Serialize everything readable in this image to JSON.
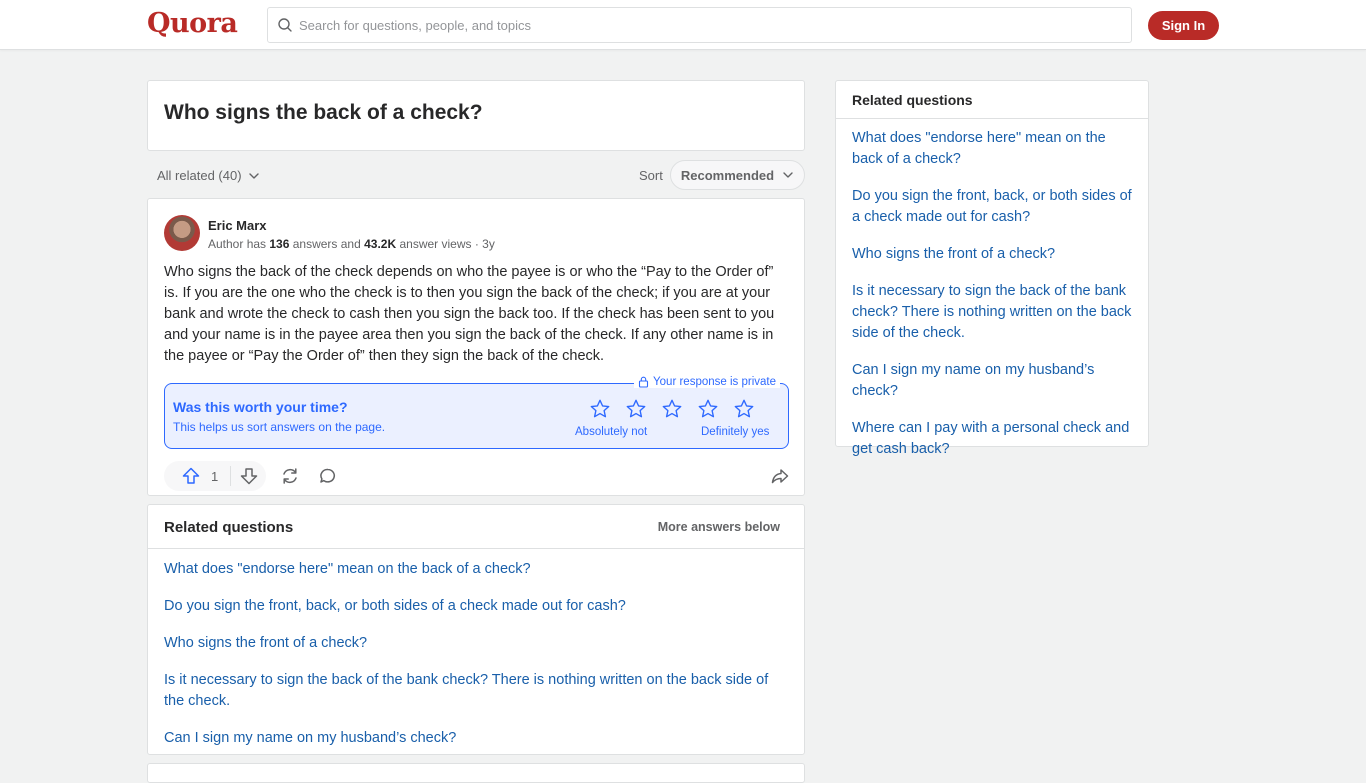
{
  "header": {
    "logo": "Quora",
    "search_placeholder": "Search for questions, people, and topics",
    "signin_label": "Sign In",
    "brand_color": "#b92b27"
  },
  "question": {
    "title": "Who signs the back of a check?"
  },
  "filters": {
    "all_related": "All related (40)",
    "sort_label": "Sort",
    "sort_value": "Recommended"
  },
  "answer": {
    "author": "Eric Marx",
    "meta_prefix": "Author has ",
    "answers_count": "136",
    "meta_mid": " answers and ",
    "views_count": "43.2K",
    "meta_suffix": " answer views · 3y",
    "text": "Who signs the back of the check depends on who the payee is or who the “Pay to the Order of” is. If you are the one who the check is to then you sign the back of the check; if you are at your bank and wrote the check to cash then you sign the back too. If the check has been sent to you and your name is in the payee area then you sign the back of the check. If any other name is in the payee or “Pay the Order of” then they sign the back of the check.",
    "upvotes": "1"
  },
  "survey": {
    "private_label": "Your response is private",
    "title": "Was this worth your time?",
    "subtitle": "This helps us sort answers on the page.",
    "low_label": "Absolutely not",
    "high_label": "Definitely yes",
    "accent_color": "#2e69ff"
  },
  "related": {
    "title": "Related questions",
    "more_below": "More answers below",
    "items": [
      "What does \"endorse here\" mean on the back of a check?",
      "Do you sign the front, back, or both sides of a check made out for cash?",
      "Who signs the front of a check?",
      "Is it necessary to sign the back of the bank check? There is nothing written on the back side of the check.",
      "Can I sign my name on my husband’s check?"
    ]
  },
  "sidebar": {
    "title": "Related questions",
    "items": [
      "What does \"endorse here\" mean on the back of a check?",
      "Do you sign the front, back, or both sides of a check made out for cash?",
      "Who signs the front of a check?",
      "Is it necessary to sign the back of the bank check? There is nothing written on the back side of the check.",
      "Can I sign my name on my husband’s check?",
      "Where can I pay with a personal check and get cash back?"
    ]
  },
  "icons": {
    "search": "search-icon",
    "chevron": "chevron-down-icon",
    "lock": "lock-icon",
    "star": "star-icon",
    "upvote": "upvote-icon",
    "downvote": "downvote-icon",
    "share_retry": "reshare-icon",
    "comment": "comment-icon",
    "share": "share-icon"
  }
}
